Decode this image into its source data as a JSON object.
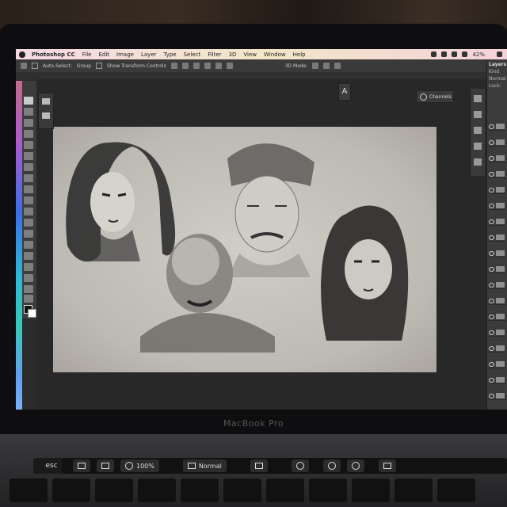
{
  "menubar": {
    "app": "Photoshop CC",
    "items": [
      "File",
      "Edit",
      "Image",
      "Layer",
      "Type",
      "Select",
      "Filter",
      "3D",
      "View",
      "Window",
      "Help"
    ],
    "battery": "42%"
  },
  "options_bar": {
    "auto_select_label": "Auto-Select:",
    "auto_select_value": "Group",
    "transform_label": "Show Transform Controls",
    "mode_label": "3D Mode:"
  },
  "panels": {
    "channels_label": "Channels",
    "layers_title": "Layers",
    "layers_filter": "Kind",
    "blend_mode": "Normal",
    "lock_label": "Lock:"
  },
  "laptop": {
    "brand": "MacBook Pro"
  },
  "touchbar": {
    "esc": "esc",
    "zoom": "100%",
    "blend": "Normal"
  },
  "colors": {
    "canvas": "#c8c4be",
    "ui_dark": "#2b2b2b",
    "menubar": "#f3dde6"
  }
}
